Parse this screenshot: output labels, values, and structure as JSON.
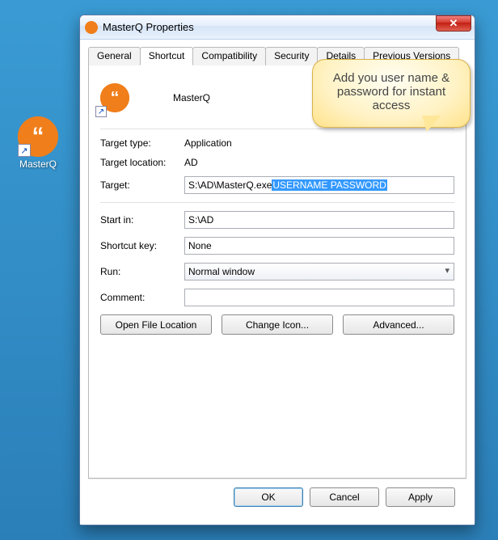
{
  "desktop": {
    "icon_label": "MasterQ"
  },
  "window": {
    "title": "MasterQ Properties"
  },
  "tabs": {
    "general": "General",
    "shortcut": "Shortcut",
    "compatibility": "Compatibility",
    "security": "Security",
    "details": "Details",
    "previous": "Previous Versions"
  },
  "shortcut": {
    "name": "MasterQ",
    "target_type_label": "Target type:",
    "target_type_value": "Application",
    "target_location_label": "Target location:",
    "target_location_value": "AD",
    "target_label": "Target:",
    "target_prefix": "S:\\AD\\MasterQ.exe ",
    "target_selected": "USERNAME PASSWORD",
    "startin_label": "Start in:",
    "startin_value": "S:\\AD",
    "shortcutkey_label": "Shortcut key:",
    "shortcutkey_value": "None",
    "run_label": "Run:",
    "run_value": "Normal window",
    "comment_label": "Comment:",
    "comment_value": "",
    "open_file_location": "Open File Location",
    "change_icon": "Change Icon...",
    "advanced": "Advanced..."
  },
  "buttons": {
    "ok": "OK",
    "cancel": "Cancel",
    "apply": "Apply"
  },
  "callout": {
    "text": "Add you user name & password for instant access"
  }
}
